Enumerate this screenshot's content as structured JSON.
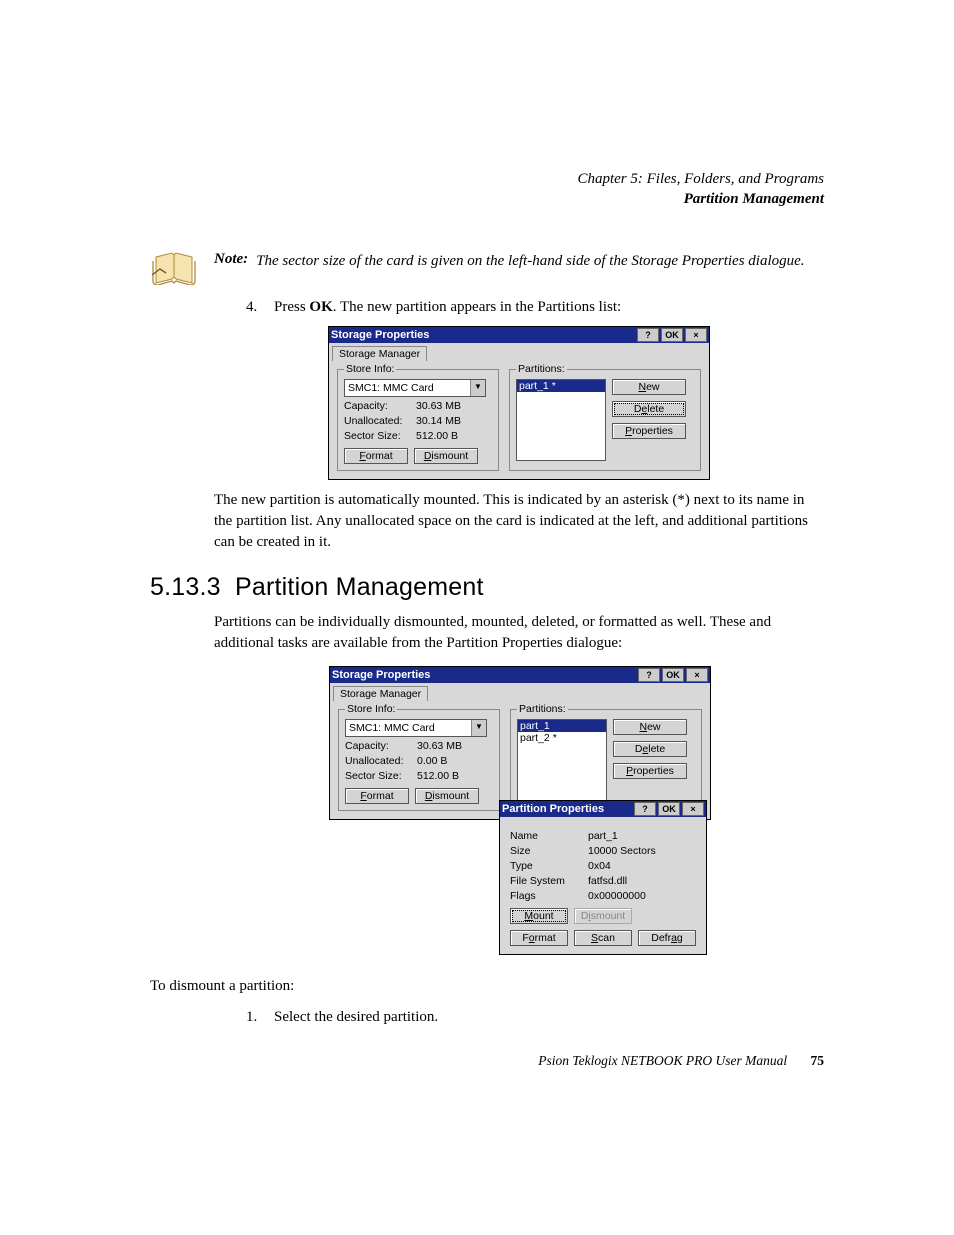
{
  "header": {
    "chapter": "Chapter 5:  Files, Folders, and Programs",
    "section": "Partition Management"
  },
  "note": {
    "label": "Note:",
    "text": "The sector size of the card is given on the left-hand side of the Storage Properties dialogue."
  },
  "step4": {
    "num": "4.",
    "pre": "Press ",
    "bold": "OK",
    "post": ". The new partition appears in the Partitions list:"
  },
  "dialog1": {
    "title": "Storage Properties",
    "help": "?",
    "ok": "OK",
    "close": "×",
    "tab": "Storage Manager",
    "storeInfo": {
      "legend": "Store Info:",
      "device": "SMC1: MMC Card",
      "capacityLabel": "Capacity:",
      "capacity": "30.63 MB",
      "unallocLabel": "Unallocated:",
      "unalloc": "30.14 MB",
      "sectorLabel": "Sector Size:",
      "sector": "512.00 B",
      "format": "Format",
      "dismount": "Dismount"
    },
    "partitions": {
      "legend": "Partitions:",
      "items": [
        "part_1 *"
      ],
      "new": "New",
      "delete": "Delete",
      "properties": "Properties"
    }
  },
  "afterDialog1": "The new partition is automatically mounted. This is indicated by an asterisk (*) next to its name in the partition list. Any unallocated space on the card is indicated at the left, and additional partitions can be created in it.",
  "heading": {
    "num": "5.13.3",
    "title": "Partition Management"
  },
  "pm_intro": "Partitions can be individually dismounted, mounted, deleted, or formatted as well. These and additional tasks are available from the Partition Properties dialogue:",
  "dialog2": {
    "title": "Storage Properties",
    "tab": "Storage Manager",
    "storeInfo": {
      "legend": "Store Info:",
      "device": "SMC1: MMC Card",
      "capacityLabel": "Capacity:",
      "capacity": "30.63 MB",
      "unallocLabel": "Unallocated:",
      "unalloc": "0.00 B",
      "sectorLabel": "Sector Size:",
      "sector": "512.00 B",
      "format": "Format",
      "dismount": "Dismount"
    },
    "partitions": {
      "legend": "Partitions:",
      "items": [
        "part_1",
        "part_2 *"
      ],
      "new": "New",
      "delete": "Delete",
      "properties": "Properties"
    }
  },
  "partprops": {
    "title": "Partition Properties",
    "help": "?",
    "ok": "OK",
    "close": "×",
    "nameLabel": "Name",
    "name": "part_1",
    "sizeLabel": "Size",
    "size": "10000 Sectors",
    "typeLabel": "Type",
    "type": "0x04",
    "fsLabel": "File System",
    "fs": "fatfsd.dll",
    "flagsLabel": "Flags",
    "flags": "0x00000000",
    "mount": "Mount",
    "dismount": "Dismount",
    "format": "Format",
    "scan": "Scan",
    "defrag": "Defrag"
  },
  "dismount_intro": "To dismount a partition:",
  "step_d1": {
    "num": "1.",
    "text": "Select the desired partition."
  },
  "footer": {
    "text": "Psion Teklogix NETBOOK PRO User Manual",
    "page": "75"
  }
}
